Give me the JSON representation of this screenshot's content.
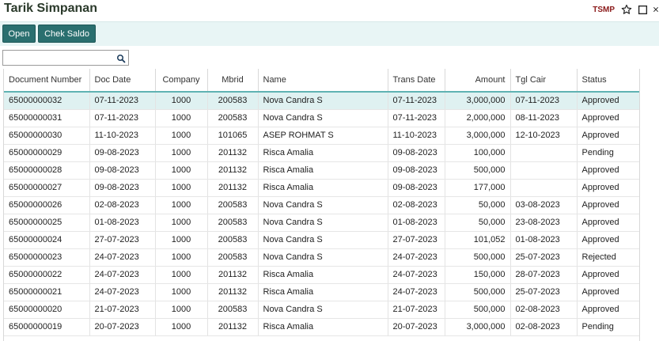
{
  "header": {
    "title": "Tarik Simpanan",
    "code": "TSMP"
  },
  "toolbar": {
    "open_label": "Open",
    "chek_label": "Chek Saldo"
  },
  "search": {
    "value": "",
    "placeholder": ""
  },
  "table": {
    "columns": [
      "Document Number",
      "Doc Date",
      "Company",
      "Mbrid",
      "Name",
      "Trans Date",
      "Amount",
      "Tgl Cair",
      "Status"
    ],
    "rows": [
      [
        "65000000032",
        "07-11-2023",
        "1000",
        "200583",
        "Nova Candra S",
        "07-11-2023",
        "3,000,000",
        "07-11-2023",
        "Approved"
      ],
      [
        "65000000031",
        "07-11-2023",
        "1000",
        "200583",
        "Nova Candra S",
        "07-11-2023",
        "2,000,000",
        "08-11-2023",
        "Approved"
      ],
      [
        "65000000030",
        "11-10-2023",
        "1000",
        "101065",
        "ASEP ROHMAT S",
        "11-10-2023",
        "3,000,000",
        "12-10-2023",
        "Approved"
      ],
      [
        "65000000029",
        "09-08-2023",
        "1000",
        "201132",
        "Risca Amalia",
        "09-08-2023",
        "100,000",
        "",
        "Pending"
      ],
      [
        "65000000028",
        "09-08-2023",
        "1000",
        "201132",
        "Risca Amalia",
        "09-08-2023",
        "500,000",
        "",
        "Approved"
      ],
      [
        "65000000027",
        "09-08-2023",
        "1000",
        "201132",
        "Risca Amalia",
        "09-08-2023",
        "177,000",
        "",
        "Approved"
      ],
      [
        "65000000026",
        "02-08-2023",
        "1000",
        "200583",
        "Nova Candra S",
        "02-08-2023",
        "50,000",
        "03-08-2023",
        "Approved"
      ],
      [
        "65000000025",
        "01-08-2023",
        "1000",
        "200583",
        "Nova Candra S",
        "01-08-2023",
        "50,000",
        "23-08-2023",
        "Approved"
      ],
      [
        "65000000024",
        "27-07-2023",
        "1000",
        "200583",
        "Nova Candra S",
        "27-07-2023",
        "101,052",
        "01-08-2023",
        "Approved"
      ],
      [
        "65000000023",
        "24-07-2023",
        "1000",
        "200583",
        "Nova Candra S",
        "24-07-2023",
        "500,000",
        "25-07-2023",
        "Rejected"
      ],
      [
        "65000000022",
        "24-07-2023",
        "1000",
        "201132",
        "Risca Amalia",
        "24-07-2023",
        "150,000",
        "28-07-2023",
        "Approved"
      ],
      [
        "65000000021",
        "24-07-2023",
        "1000",
        "201132",
        "Risca Amalia",
        "24-07-2023",
        "500,000",
        "25-07-2023",
        "Approved"
      ],
      [
        "65000000020",
        "21-07-2023",
        "1000",
        "200583",
        "Nova Candra S",
        "21-07-2023",
        "500,000",
        "02-08-2023",
        "Approved"
      ],
      [
        "65000000019",
        "20-07-2023",
        "1000",
        "201132",
        "Risca Amalia",
        "20-07-2023",
        "3,000,000",
        "02-08-2023",
        "Pending"
      ]
    ]
  }
}
